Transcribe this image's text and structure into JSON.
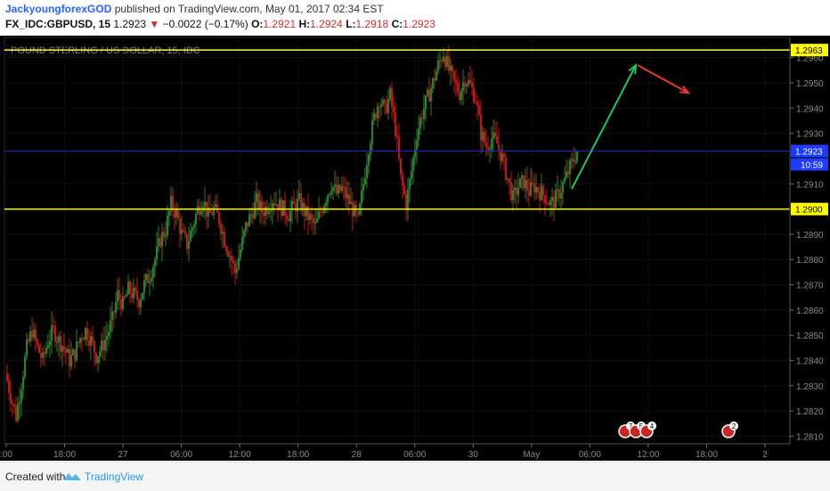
{
  "header": {
    "author": "JackyoungforexGOD",
    "published_text": "published on TradingView.com, May 01, 2017 02:34 EST",
    "symbol": "FX_IDC:GBPUSD, 15",
    "last": "1.2923",
    "change_arrow": "▼",
    "change": "−0.0022 (−0.17%)",
    "o_label": "O:",
    "o_value": "1.2921",
    "h_label": "H:",
    "h_value": "1.2924",
    "l_label": "L:",
    "l_value": "1.2918",
    "c_label": "C:",
    "c_value": "1.2923"
  },
  "footer": {
    "created_with": "Created with",
    "brand": "TradingView",
    "logo_icon": "tradingview-logo-icon"
  },
  "chart_data": {
    "type": "candlestick",
    "title": "POUND STERLING / US DOLLAR, 15, IDC",
    "background": "#000000",
    "up_color": "#2e7d32",
    "down_color": "#b71c1c",
    "y_ticks": [
      "1.2960",
      "1.2950",
      "1.2940",
      "1.2930",
      "1.2910",
      "1.2890",
      "1.2880",
      "1.2870",
      "1.2860",
      "1.2850",
      "1.2840",
      "1.2830",
      "1.2820",
      "1.2810"
    ],
    "ylim": [
      1.2807,
      1.2968
    ],
    "x_ticks": [
      ":00",
      "18:00",
      "27",
      "06:00",
      "12:00",
      "18:00",
      "28",
      "06:00",
      "30",
      "May",
      "06:00",
      "12:00",
      "18:00",
      "2"
    ],
    "price_labels": [
      {
        "value": 1.2963,
        "text": "1.2963",
        "color": "#ffff00"
      },
      {
        "value": 1.2923,
        "text": "1.2923",
        "color": "#1e3cff"
      },
      {
        "value": 1.29,
        "text": "1.2900",
        "color": "#ffff00"
      }
    ],
    "countdown": "10:59",
    "horizontal_lines": [
      {
        "value": 1.2963,
        "color": "#ffff00"
      },
      {
        "value": 1.2923,
        "color": "#2020c0"
      },
      {
        "value": 1.29,
        "color": "#ffff00"
      }
    ],
    "arrows": [
      {
        "color": "#22c55e",
        "from": [
          1.2908
        ],
        "to": [
          1.2957
        ]
      },
      {
        "color": "#e53935",
        "from": [
          1.2957
        ],
        "to": [
          1.2946
        ]
      }
    ],
    "event_badges": [
      "7",
      "5",
      "4",
      "2"
    ],
    "series": [
      {
        "name": "GBPUSD",
        "ohlc_path": [
          1.2835,
          1.2826,
          1.2818,
          1.2831,
          1.2845,
          1.2852,
          1.2845,
          1.284,
          1.2848,
          1.2852,
          1.2848,
          1.2845,
          1.284,
          1.2843,
          1.2849,
          1.2852,
          1.2848,
          1.2842,
          1.2845,
          1.285,
          1.2856,
          1.2866,
          1.2862,
          1.2868,
          1.2866,
          1.2864,
          1.287,
          1.2874,
          1.288,
          1.2888,
          1.2892,
          1.2902,
          1.2898,
          1.289,
          1.2886,
          1.2893,
          1.29,
          1.2904,
          1.2897,
          1.29,
          1.2896,
          1.2888,
          1.2882,
          1.2875,
          1.2884,
          1.2893,
          1.2898,
          1.2903,
          1.2899,
          1.2901,
          1.2904,
          1.2902,
          1.29,
          1.2898,
          1.2901,
          1.2903,
          1.2899,
          1.2896,
          1.2893,
          1.2899,
          1.2905,
          1.291,
          1.2906,
          1.2908,
          1.2904,
          1.29,
          1.2895,
          1.291,
          1.2925,
          1.2936,
          1.2944,
          1.2939,
          1.2945,
          1.2932,
          1.2912,
          1.2902,
          1.2915,
          1.293,
          1.2938,
          1.2944,
          1.295,
          1.2957,
          1.2962,
          1.2955,
          1.295,
          1.2946,
          1.2952,
          1.2949,
          1.2944,
          1.293,
          1.2925,
          1.2928,
          1.2926,
          1.292,
          1.2912,
          1.2904,
          1.2909,
          1.2911,
          1.2907,
          1.2909,
          1.2907,
          1.2905,
          1.2902,
          1.2904,
          1.2908,
          1.2913,
          1.2918,
          1.2923
        ]
      }
    ]
  }
}
